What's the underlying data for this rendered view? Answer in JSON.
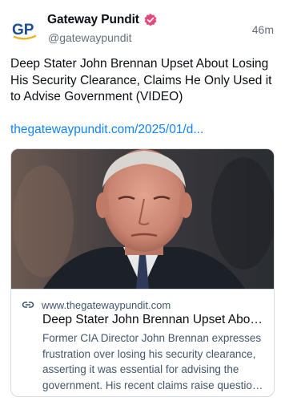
{
  "post": {
    "author": {
      "display_name": "Gateway Pundit",
      "handle": "@gatewaypundit",
      "avatar_text": "GP",
      "verified_icon": "verified-badge-icon"
    },
    "timestamp": "46m",
    "text": "Deep Stater John Brennan Upset About Losing His Security Clearance, Claims He Only Used it to Advise Government (VIDEO)",
    "link_text": "thegatewaypundit.com/2025/01/d..."
  },
  "link_card": {
    "image_alt": "John Brennan",
    "domain": "www.thegatewaypundit.com",
    "title": "Deep Stater John Brennan Upset About Losing His Security Clearance, Claims He Only Used it to Advise Government (VIDEO)",
    "description_lines": [
      "Former CIA Director John Brennan expresses",
      "frustration over losing his security clearance,",
      "asserting it was essential for advising the",
      "government. His recent claims raise questions about whether he should retain access."
    ]
  },
  "colors": {
    "link": "#1083fe",
    "muted_text": "#66707a",
    "badge": "#e8457b",
    "avatar_blue": "#1c4f8f",
    "avatar_gold": "#f0b429"
  }
}
